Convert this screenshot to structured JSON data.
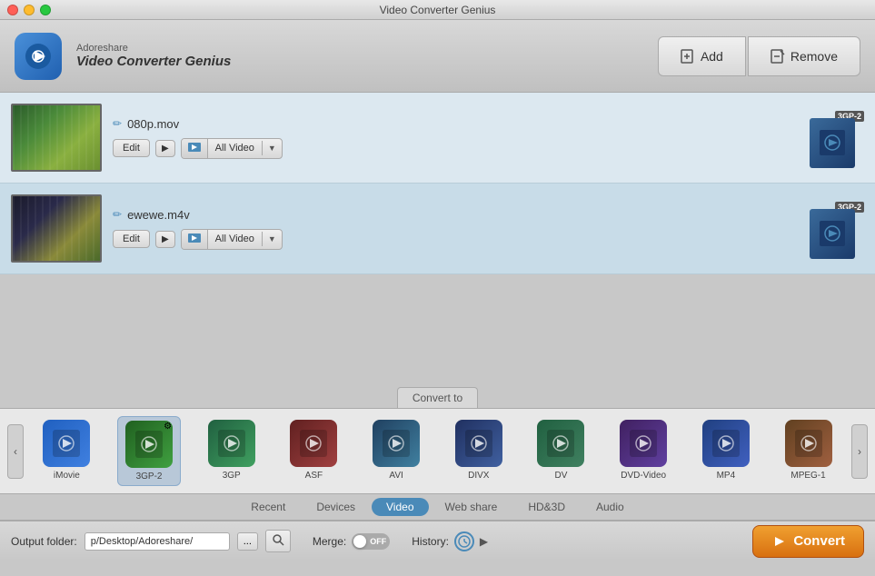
{
  "window": {
    "title": "Video Converter Genius"
  },
  "header": {
    "brand": "Adoreshare",
    "app_name": "Video Converter Genius",
    "add_label": "Add",
    "remove_label": "Remove"
  },
  "files": [
    {
      "name": "080p.mov",
      "format": "All Video",
      "output_format": "3GP-2"
    },
    {
      "name": "ewewe.m4v",
      "format": "All Video",
      "output_format": "3GP-2"
    }
  ],
  "convert_to": {
    "label": "Convert to"
  },
  "format_tabs": {
    "active": "Video",
    "tabs": [
      "Recent",
      "Devices",
      "Video",
      "Web share",
      "HD&3D",
      "Audio"
    ]
  },
  "formats": [
    {
      "id": "imovie",
      "label": "iMovie",
      "icon_text": "▶",
      "active": false,
      "has_gear": false,
      "color_class": "fmt-imovie"
    },
    {
      "id": "3gp2",
      "label": "3GP-2",
      "icon_text": "▶",
      "active": true,
      "has_gear": true,
      "color_class": "fmt-3gp2"
    },
    {
      "id": "3gp",
      "label": "3GP",
      "icon_text": "▶",
      "active": false,
      "has_gear": false,
      "color_class": "fmt-3gp"
    },
    {
      "id": "asf",
      "label": "ASF",
      "icon_text": "W",
      "active": false,
      "has_gear": false,
      "color_class": "fmt-asf"
    },
    {
      "id": "avi",
      "label": "AVI",
      "icon_text": "▶",
      "active": false,
      "has_gear": false,
      "color_class": "fmt-avi"
    },
    {
      "id": "divx",
      "label": "DIVX",
      "icon_text": "✕",
      "active": false,
      "has_gear": false,
      "color_class": "fmt-divx"
    },
    {
      "id": "dv",
      "label": "DV",
      "icon_text": "◉",
      "active": false,
      "has_gear": false,
      "color_class": "fmt-dv"
    },
    {
      "id": "dvd",
      "label": "DVD-Video",
      "icon_text": "◎",
      "active": false,
      "has_gear": false,
      "color_class": "fmt-dvd"
    },
    {
      "id": "mp4",
      "label": "MP4",
      "icon_text": "▶",
      "active": false,
      "has_gear": false,
      "color_class": "fmt-mp4"
    },
    {
      "id": "mpeg1",
      "label": "MPEG-1",
      "icon_text": "▶",
      "active": false,
      "has_gear": false,
      "color_class": "fmt-mpeg1"
    }
  ],
  "bottom": {
    "output_label": "Output folder:",
    "output_path": "p/Desktop/Adoreshare/",
    "dots_label": "...",
    "merge_label": "Merge:",
    "toggle_state": "OFF",
    "history_label": "History:",
    "convert_label": "Convert"
  }
}
